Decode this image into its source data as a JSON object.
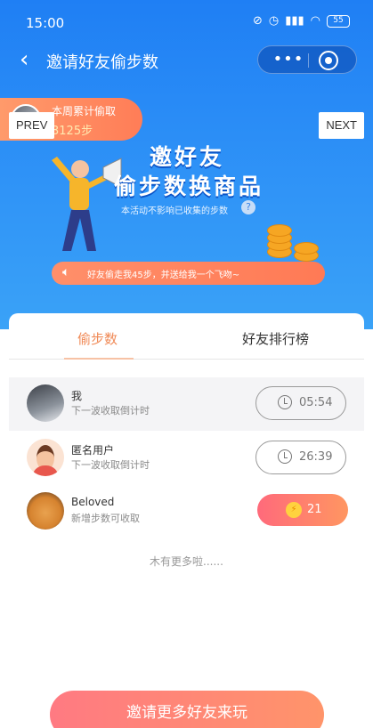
{
  "status_bar": {
    "time": "15:00",
    "battery": "55"
  },
  "nav": {
    "title": "邀请好友偷步数",
    "more_icon": "more-dots-icon",
    "close_icon": "target-circle-icon",
    "more_glyph": "•••"
  },
  "banner": {
    "weekly_label": "本周累计偷取",
    "weekly_steps": "3125步",
    "headline_line1": "邀好友",
    "headline_line2": "偷步数换商品",
    "note": "本活动不影响已收集的步数",
    "help_glyph": "?",
    "notice": "好友偷走我45步，并送给我一个飞吻~"
  },
  "pager": {
    "prev": "PREV",
    "next": "NEXT"
  },
  "tabs": {
    "steal": "偷步数",
    "ranking": "好友排行榜"
  },
  "friends": [
    {
      "name": "我",
      "desc": "下一波收取倒计时",
      "action": "05:54",
      "action_type": "timer"
    },
    {
      "name": "匿名用户",
      "desc": "下一波收取倒计时",
      "action": "26:39",
      "action_type": "timer"
    },
    {
      "name": "Beloved",
      "desc": "新增步数可收取",
      "action": "21",
      "action_type": "collect"
    }
  ],
  "footer": {
    "no_more": "木有更多啦......",
    "invite_button": "邀请更多好友来玩"
  },
  "colors": {
    "brand_blue": "#1f7ff4",
    "accent_orange": "#f08a57",
    "collect_gradient_start": "#ff6a7b"
  }
}
